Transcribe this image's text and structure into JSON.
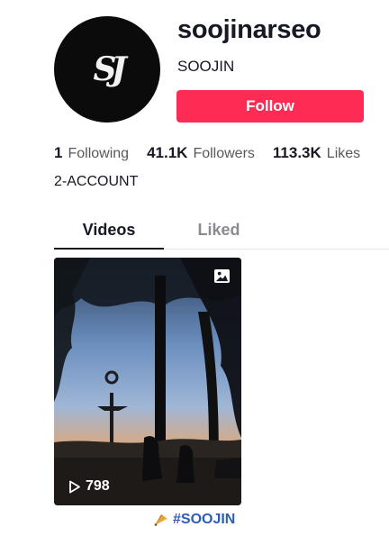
{
  "profile": {
    "avatar_monogram": "SJ",
    "username": "soojinarseo",
    "nickname": "SOOJIN",
    "follow_label": "Follow",
    "bio": "2-ACCOUNT"
  },
  "stats": [
    {
      "value": "1",
      "label": "Following"
    },
    {
      "value": "41.1K",
      "label": "Followers"
    },
    {
      "value": "113.3K",
      "label": "Likes"
    }
  ],
  "tabs": [
    {
      "label": "Videos",
      "active": true
    },
    {
      "label": "Liked",
      "active": false
    }
  ],
  "videos": [
    {
      "views": "798",
      "badge_icon": "photo-icon",
      "caption_emoji": "fan-icon",
      "caption_text": "#SOOJIN"
    }
  ],
  "colors": {
    "accent": "#fe2c55",
    "text_primary": "#161823",
    "text_secondary": "#57585e",
    "tab_inactive": "#8a8b91",
    "hashtag": "#2b5db9"
  }
}
